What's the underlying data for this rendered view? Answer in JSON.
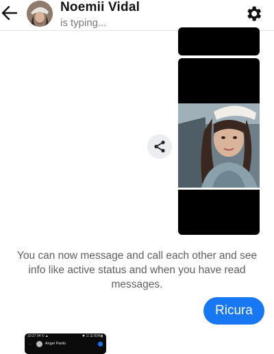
{
  "header": {
    "contact_name": "Noemii Vidal",
    "status": "is typing..."
  },
  "conversation": {
    "info_message": "You can now message and call each other and see info like active status and when you have read messages.",
    "outgoing_message": "Ricura"
  },
  "shared_screenshot": {
    "status_time": "10:27 94 © ▲",
    "status_right": "✹ ☷ ☰ 83%▮",
    "contact_name": "Angel Pardo"
  },
  "icons": {
    "back": "arrow-left-icon",
    "settings": "gear-icon",
    "share": "share-icon"
  },
  "colors": {
    "accent": "#1877f2",
    "share_bg": "#ebedf0",
    "info_text": "#5f5f5f"
  }
}
